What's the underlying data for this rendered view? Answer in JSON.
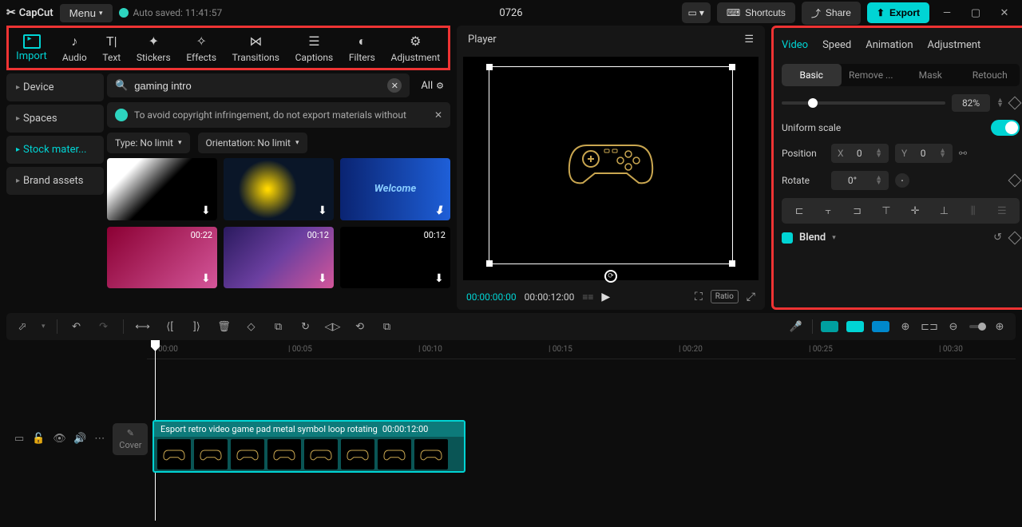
{
  "titlebar": {
    "brand": "CapCut",
    "menu": "Menu",
    "autosave": "Auto saved: 11:41:57",
    "title": "0726",
    "shortcuts": "Shortcuts",
    "share": "Share",
    "export": "Export"
  },
  "import": {
    "label": "Import"
  },
  "tool_tabs": [
    {
      "label": "Audio"
    },
    {
      "label": "Text"
    },
    {
      "label": "Stickers"
    },
    {
      "label": "Effects"
    },
    {
      "label": "Transitions"
    },
    {
      "label": "Captions"
    },
    {
      "label": "Filters"
    },
    {
      "label": "Adjustment"
    }
  ],
  "side_items": [
    {
      "label": "Device",
      "active": false
    },
    {
      "label": "Spaces",
      "active": false
    },
    {
      "label": "Stock mater...",
      "active": true
    },
    {
      "label": "Brand assets",
      "active": false
    }
  ],
  "search": {
    "query": "gaming intro",
    "all": "All"
  },
  "warning": "To avoid copyright infringement, do not export materials without",
  "filters": {
    "type": "Type: No limit",
    "orientation": "Orientation: No limit"
  },
  "thumbs": [
    {
      "dur": "",
      "cls": "t1"
    },
    {
      "dur": "",
      "cls": "t2"
    },
    {
      "dur": "",
      "cls": "t3",
      "txt": "Welcome"
    },
    {
      "dur": "00:22",
      "cls": "t4"
    },
    {
      "dur": "00:12",
      "cls": "t5"
    },
    {
      "dur": "00:12",
      "cls": "t6"
    }
  ],
  "player": {
    "title": "Player",
    "current": "00:00:00:00",
    "total": "00:00:12:00",
    "ratio": "Ratio"
  },
  "props": {
    "tabs": [
      "Video",
      "Speed",
      "Animation",
      "Adjustment"
    ],
    "subtabs": [
      "Basic",
      "Remove ...",
      "Mask",
      "Retouch"
    ],
    "scale_pct": "82%",
    "uniform": "Uniform scale",
    "position": "Position",
    "x_lbl": "X",
    "x_val": "0",
    "y_lbl": "Y",
    "y_val": "0",
    "rotate": "Rotate",
    "rotate_val": "0°",
    "blend": "Blend"
  },
  "ruler": [
    "00:00",
    "| 00:05",
    "| 00:10",
    "| 00:15",
    "| 00:20",
    "| 00:25",
    "| 00:30"
  ],
  "cover": "Cover",
  "clip": {
    "name": "Esport retro video game pad metal symbol loop rotating",
    "dur": "00:00:12:00"
  }
}
